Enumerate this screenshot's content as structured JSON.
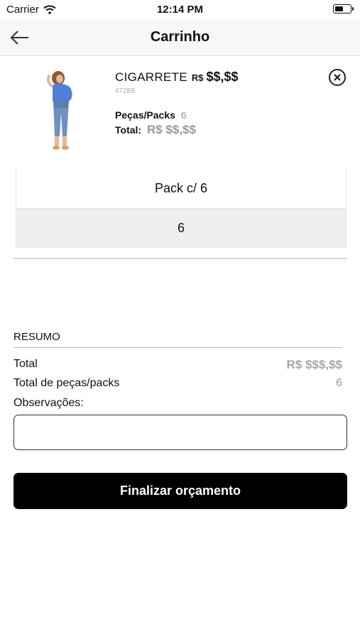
{
  "status_bar": {
    "carrier": "Carrier",
    "time": "12:14 PM",
    "wifi_icon": "wifi-icon",
    "battery_icon": "battery-icon",
    "battery_level_fraction": 0.6
  },
  "nav": {
    "title": "Carrinho",
    "back_icon": "arrow-left-icon"
  },
  "cart_item": {
    "name": "CIGARRETE",
    "price_currency": "R$",
    "price_value": "$$,$$",
    "sku": "47289.",
    "pieces_label": "Peças/Packs",
    "pieces_value": "6",
    "total_label": "Total:",
    "total_value": "R$ $$,$$",
    "remove_icon": "close-circle-icon",
    "image_icon": "product-photo"
  },
  "pack_table": {
    "header": "Pack c/ 6",
    "value": "6"
  },
  "summary": {
    "heading": "RESUMO",
    "total_label": "Total",
    "total_value": "R$ $$$,$$",
    "pieces_label": "Total de peças/packs",
    "pieces_value": "6",
    "notes_label": "Observações:",
    "notes_value": "",
    "notes_placeholder": ""
  },
  "actions": {
    "submit_label": "Finalizar orçamento"
  },
  "colors": {
    "primary_button": "#000000",
    "muted_text": "#999999",
    "nav_background": "#f7f7f7"
  }
}
